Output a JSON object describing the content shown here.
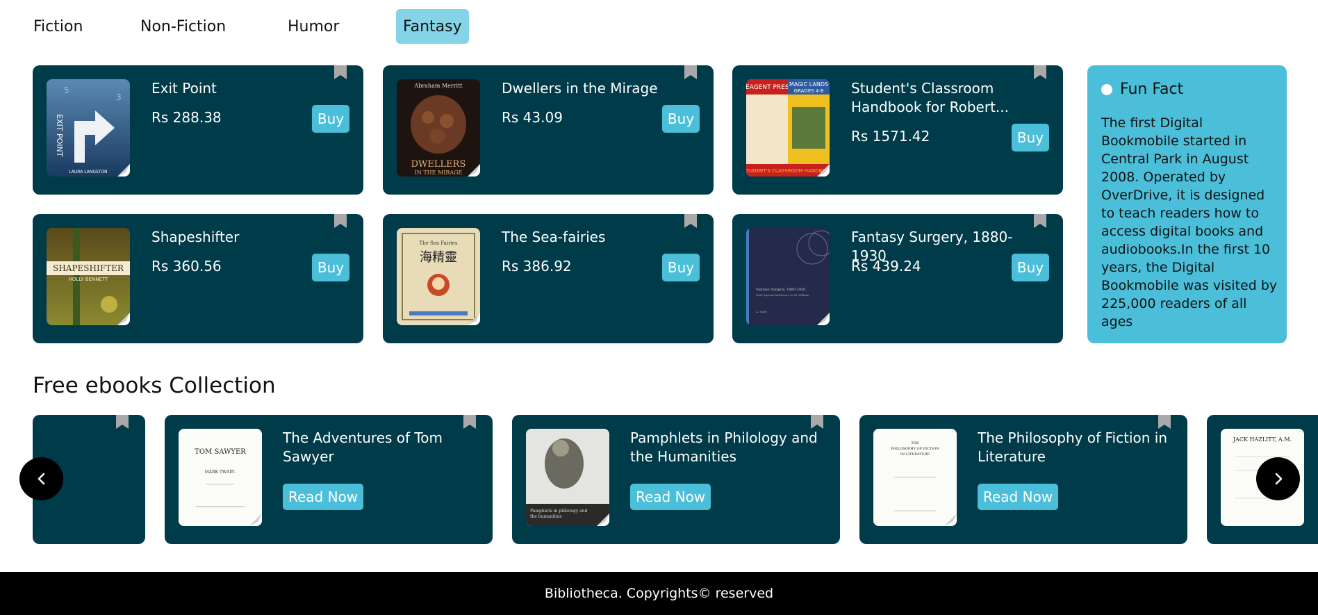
{
  "tabs": [
    {
      "label": "Fiction"
    },
    {
      "label": "Non-Fiction"
    },
    {
      "label": "Humor"
    },
    {
      "label": "Fantasy",
      "active": true
    }
  ],
  "books": [
    {
      "title": "Exit Point",
      "price": "Rs 288.38",
      "buy": "Buy"
    },
    {
      "title": "Dwellers in the Mirage",
      "price": "Rs 43.09",
      "buy": "Buy"
    },
    {
      "title": "Student's Classroom Handbook for Robert...",
      "price": "Rs 1571.42",
      "buy": "Buy"
    },
    {
      "title": "Shapeshifter",
      "price": "Rs 360.56",
      "buy": "Buy"
    },
    {
      "title": "The Sea-fairies",
      "price": "Rs 386.92",
      "buy": "Buy"
    },
    {
      "title": "Fantasy Surgery, 1880-1930",
      "price": "Rs 439.24",
      "buy": "Buy"
    }
  ],
  "covers": {
    "exit_point": {
      "author": "LAURA LANGSTON",
      "title_text": "EXIT POINT"
    },
    "dwellers": {
      "author": "Abraham Merritt",
      "title_text": "DWELLERS IN THE MIRAGE"
    },
    "student": {
      "left_text": "REAGENT PRESS",
      "right_text": "MAGIC LANDS",
      "sub": "GRADES 4-8",
      "bottom": "STUDENT'S CLASSROOM HANDBOOK"
    },
    "shapeshifter": {
      "title_text": "SHAPESHIFTER",
      "author": "HOLLY BENNETT"
    },
    "seafairies": {
      "title_text": "The Sea Fairies",
      "chinese": "海精靈"
    },
    "surgery": {
      "title_text": "Fantasy Surgery, 1880-1930"
    }
  },
  "fun_fact": {
    "title": "Fun Fact",
    "text": "The first Digital Bookmobile started in Central Park in August 2008. Operated by OverDrive, it is designed to teach readers how to access digital books and audiobooks.In the first 10 years, the Digital Bookmobile was visited by 225,000 readers of all ages"
  },
  "free_section": {
    "title": "Free ebooks Collection",
    "items": [
      {
        "title": "The Adventures of Tom Sawyer",
        "button": "Read Now",
        "cover_title": "TOM SAWYER",
        "cover_author": "MARK TWAIN."
      },
      {
        "title": "Pamphlets in Philology and the Humanities",
        "button": "Read Now",
        "cover_title": "Pamphlets in philology and the humanities"
      },
      {
        "title": "The Philosophy of Fiction in Literature",
        "button": "Read Now",
        "cover_title": "THE PHILOSOPHY OF FICTION IN LITERATURE"
      }
    ],
    "partial_cover_title": "JACK HAZLITT, A.M."
  },
  "footer": {
    "text": "Bibliotheca. Copyrights© reserved"
  },
  "colors": {
    "card_bg": "#003b4a",
    "accent": "#4bbfd9",
    "active_tab": "#84d3e6"
  },
  "icons": {
    "bookmark": "bookmark-icon",
    "prev": "chevron-left-icon",
    "next": "chevron-right-icon"
  }
}
